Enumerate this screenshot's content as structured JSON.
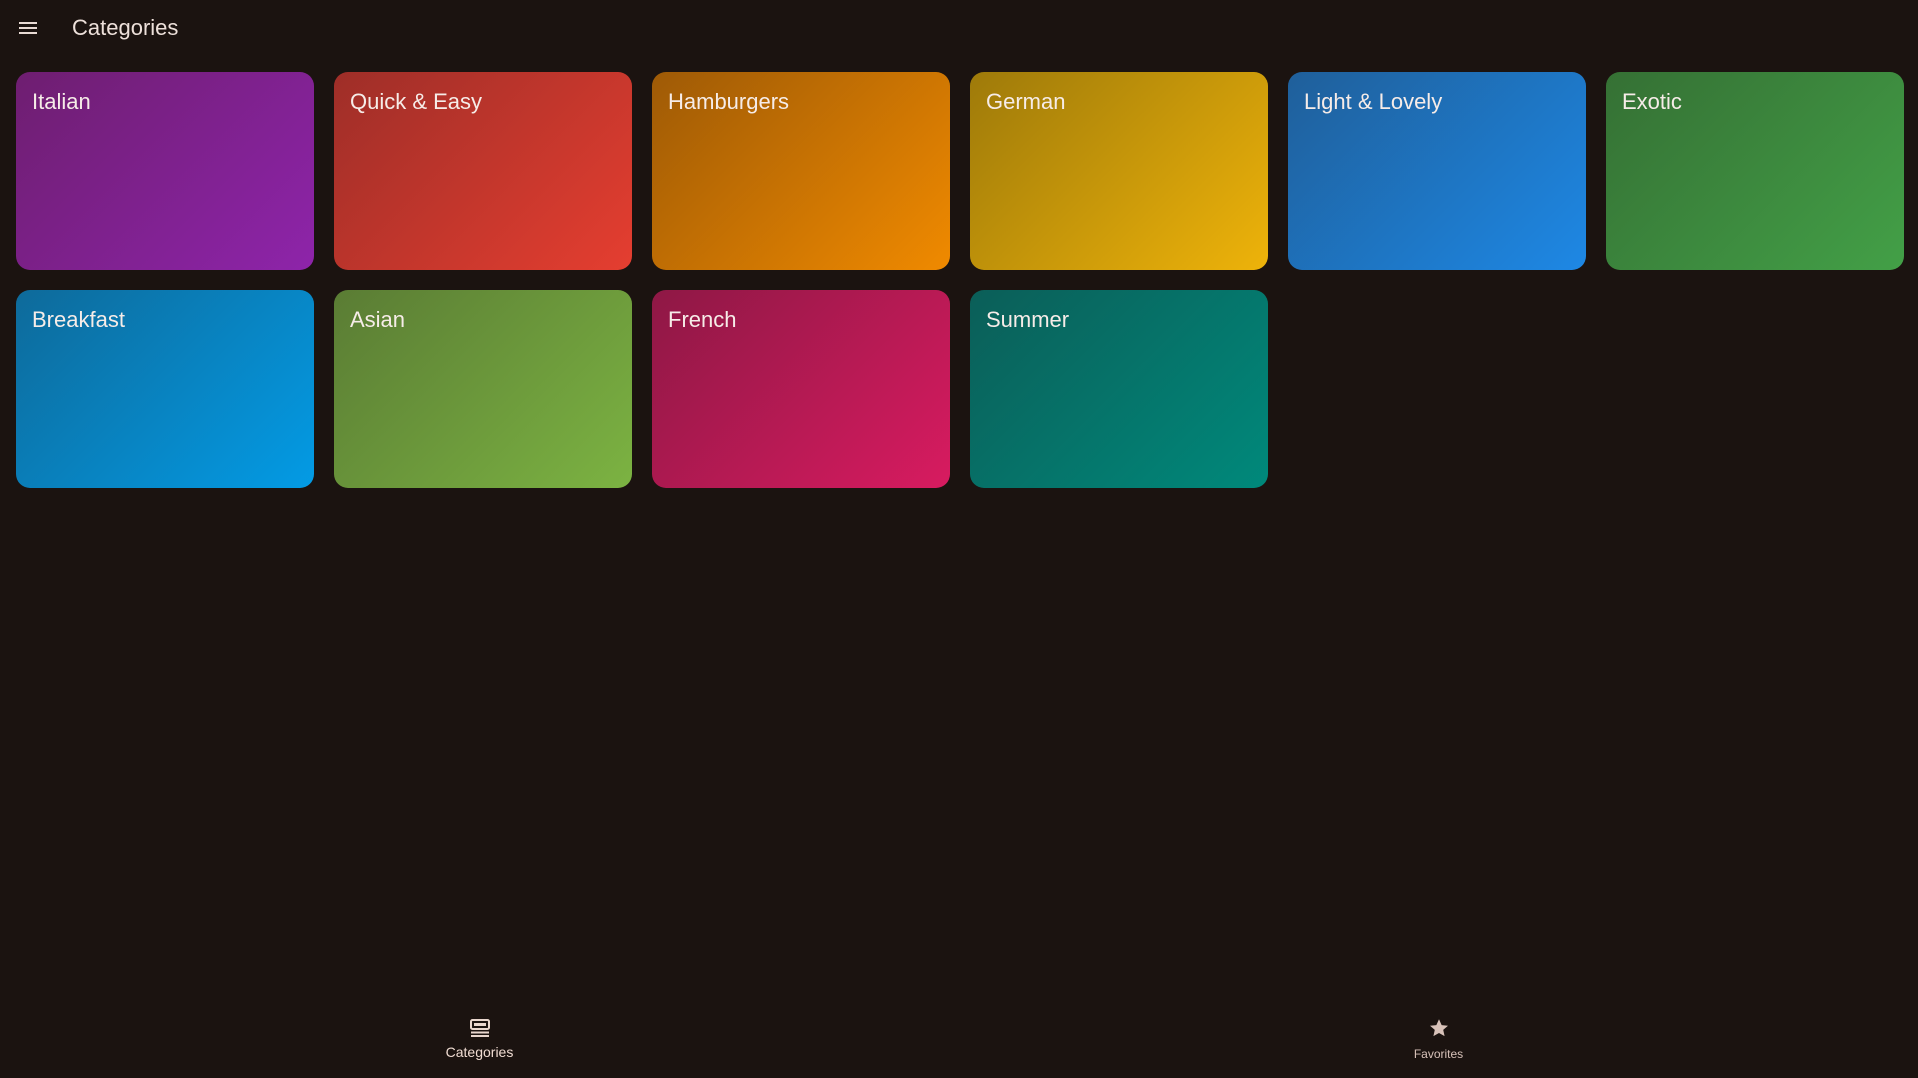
{
  "appbar": {
    "title": "Categories",
    "menu_icon": "menu-icon"
  },
  "categories": [
    {
      "label": "Italian",
      "color_from": "#6e1e70",
      "color_to": "#8e24aa"
    },
    {
      "label": "Quick & Easy",
      "color_from": "#9e2e28",
      "color_to": "#e53e30"
    },
    {
      "label": "Hamburgers",
      "color_from": "#9e5a06",
      "color_to": "#f08a00"
    },
    {
      "label": "German",
      "color_from": "#9e7a0a",
      "color_to": "#eeb30a"
    },
    {
      "label": "Light & Lovely",
      "color_from": "#1f5f9a",
      "color_to": "#1e88e5"
    },
    {
      "label": "Exotic",
      "color_from": "#357034",
      "color_to": "#43a047"
    },
    {
      "label": "Breakfast",
      "color_from": "#0e6a9a",
      "color_to": "#039be5"
    },
    {
      "label": "Asian",
      "color_from": "#5a7c34",
      "color_to": "#7cb342"
    },
    {
      "label": "French",
      "color_from": "#8e1845",
      "color_to": "#d81b60"
    },
    {
      "label": "Summer",
      "color_from": "#0b5e58",
      "color_to": "#00897b"
    }
  ],
  "bottom_nav": {
    "items": [
      {
        "label": "Categories",
        "icon": "set-meal-icon",
        "active": true
      },
      {
        "label": "Favorites",
        "icon": "star-icon",
        "active": false
      }
    ]
  }
}
